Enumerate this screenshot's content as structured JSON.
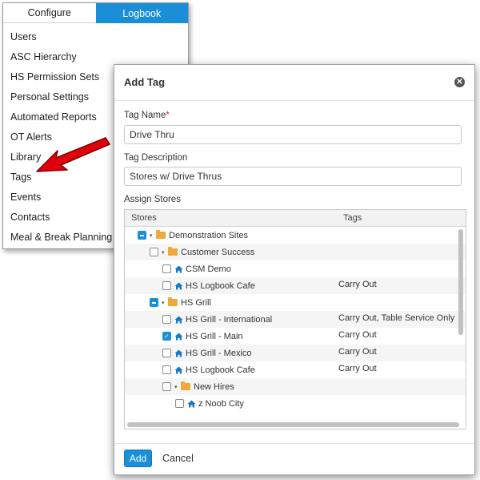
{
  "menu": {
    "tabs": [
      {
        "label": "Configure",
        "active": false
      },
      {
        "label": "Logbook",
        "active": true
      }
    ],
    "items": [
      {
        "label": "Users"
      },
      {
        "label": "ASC Hierarchy"
      },
      {
        "label": "HS Permission Sets"
      },
      {
        "label": "Personal Settings"
      },
      {
        "label": "Automated Reports"
      },
      {
        "label": "OT Alerts"
      },
      {
        "label": "Library"
      },
      {
        "label": "Tags"
      },
      {
        "label": "Events"
      },
      {
        "label": "Contacts"
      },
      {
        "label": "Meal & Break Planning"
      }
    ]
  },
  "dialog": {
    "title": "Add Tag",
    "tag_name": {
      "label": "Tag Name",
      "required_marker": "*",
      "value": "Drive Thru"
    },
    "tag_description": {
      "label": "Tag Description",
      "value": "Stores w/ Drive Thrus"
    },
    "assign_stores_label": "Assign Stores",
    "grid": {
      "columns": {
        "stores": "Stores",
        "tags": "Tags"
      },
      "rows": [
        {
          "name": "Demonstration Sites",
          "type": "folder",
          "level": 0,
          "check": "partial",
          "expanded": true,
          "tags": ""
        },
        {
          "name": "Customer Success",
          "type": "folder",
          "level": 1,
          "check": "none",
          "expanded": true,
          "tags": ""
        },
        {
          "name": "CSM Demo",
          "type": "store",
          "level": 2,
          "check": "none",
          "tags": ""
        },
        {
          "name": "HS Logbook Cafe",
          "type": "store",
          "level": 2,
          "check": "none",
          "tags": "Carry Out"
        },
        {
          "name": "HS Grill",
          "type": "folder",
          "level": 1,
          "check": "partial",
          "expanded": true,
          "tags": ""
        },
        {
          "name": "HS Grill - International",
          "type": "store",
          "level": 2,
          "check": "none",
          "tags": "Carry Out, Table Service Only"
        },
        {
          "name": "HS Grill - Main",
          "type": "store",
          "level": 2,
          "check": "checked",
          "tags": "Carry Out"
        },
        {
          "name": "HS Grill - Mexico",
          "type": "store",
          "level": 2,
          "check": "none",
          "tags": "Carry Out"
        },
        {
          "name": "HS Logbook Cafe",
          "type": "store",
          "level": 2,
          "check": "none",
          "tags": "Carry Out"
        },
        {
          "name": "New Hires",
          "type": "folder",
          "level": 2,
          "check": "none",
          "expanded": true,
          "tags": ""
        },
        {
          "name": "z Noob City",
          "type": "store",
          "level": 3,
          "check": "none",
          "tags": ""
        }
      ]
    },
    "buttons": {
      "add": "Add",
      "cancel": "Cancel"
    },
    "colors": {
      "accent": "#1a8fd8",
      "folder": "#f0a83c",
      "required": "#dd2233",
      "arrow": "#e0000b"
    }
  }
}
